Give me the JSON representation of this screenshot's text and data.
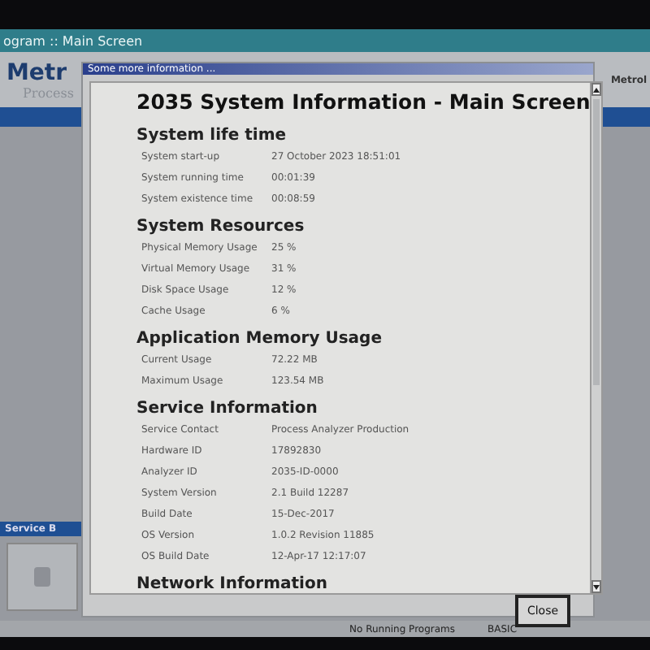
{
  "app": {
    "title": "ogram :: Main Screen",
    "logo": "Metr",
    "logo_sub": "Process",
    "right_logo": "Metrol"
  },
  "side_panel": {
    "title": "Service B"
  },
  "status_bar": [
    "No Running Programs",
    "BASIC"
  ],
  "dialog": {
    "title": "Some more information ...",
    "heading": "2035 System Information - Main Screen",
    "sections": [
      {
        "title": "System life time",
        "rows": [
          {
            "label": "System start-up",
            "value": "27 October 2023 18:51:01"
          },
          {
            "label": "System running time",
            "value": "00:01:39"
          },
          {
            "label": "System existence time",
            "value": "00:08:59"
          }
        ]
      },
      {
        "title": "System Resources",
        "rows": [
          {
            "label": "Physical Memory Usage",
            "value": "25 %"
          },
          {
            "label": "Virtual Memory Usage",
            "value": "31 %"
          },
          {
            "label": "Disk Space Usage",
            "value": "12 %"
          },
          {
            "label": "Cache Usage",
            "value": "6 %"
          }
        ]
      },
      {
        "title": "Application Memory Usage",
        "rows": [
          {
            "label": "Current Usage",
            "value": "72.22 MB"
          },
          {
            "label": "Maximum Usage",
            "value": "123.54 MB"
          }
        ]
      },
      {
        "title": "Service Information",
        "rows": [
          {
            "label": "Service Contact",
            "value": "Process Analyzer Production"
          },
          {
            "label": "Hardware ID",
            "value": "17892830"
          },
          {
            "label": "Analyzer ID",
            "value": "2035-ID-0000"
          },
          {
            "label": "System Version",
            "value": "2.1 Build 12287"
          },
          {
            "label": "Build Date",
            "value": "15-Dec-2017"
          },
          {
            "label": "OS Version",
            "value": "1.0.2 Revision 11885"
          },
          {
            "label": "OS Build Date",
            "value": "12-Apr-17 12:17:07"
          }
        ]
      },
      {
        "title": "Network Information"
      }
    ],
    "close_button": "Close"
  }
}
